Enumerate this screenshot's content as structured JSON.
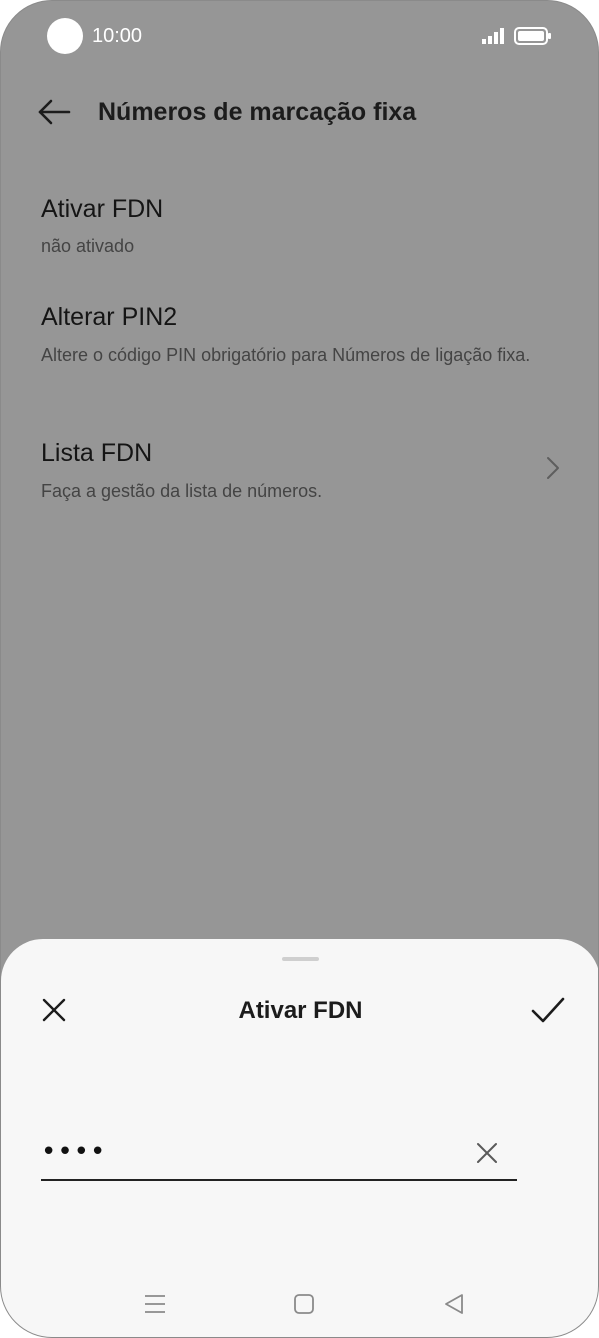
{
  "status_bar": {
    "time": "10:00",
    "icons": [
      "camera-cutout",
      "signal-icon",
      "battery-icon"
    ]
  },
  "header": {
    "title": "Números de marcação fixa",
    "back_icon": "arrow-left-icon"
  },
  "settings": [
    {
      "title": "Ativar FDN",
      "subtitle": "não ativado"
    },
    {
      "title": "Alterar PIN2",
      "subtitle": "Altere o código PIN obrigatório para Números de ligação fixa."
    },
    {
      "title": "Lista FDN",
      "subtitle": "Faça a gestão da lista de números.",
      "icon": "chevron-right-icon"
    }
  ],
  "sheet": {
    "title": "Ativar FDN",
    "close_icon": "close-icon",
    "confirm_icon": "checkmark-icon",
    "pin_value": "••••",
    "clear_icon": "clear-icon"
  },
  "nav_bar": {
    "icons": [
      "menu-icon",
      "home-icon",
      "back-triangle-icon"
    ]
  },
  "colors": {
    "overlay": "#969696",
    "sheet_background": "#f7f7f7",
    "text_primary": "#1c1c1c"
  }
}
